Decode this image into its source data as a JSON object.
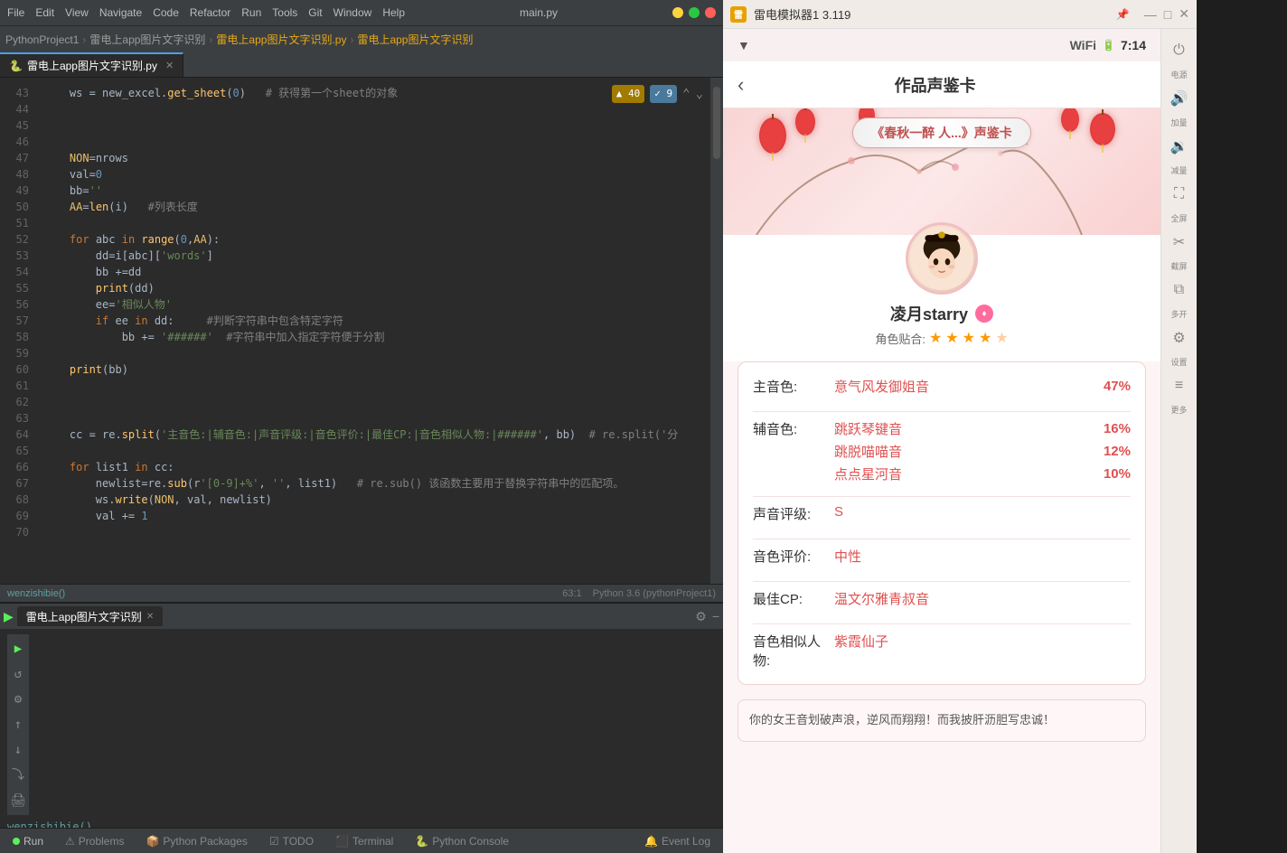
{
  "pycharm": {
    "title_bar": {
      "project": "PythonProject1",
      "menus": [
        "File",
        "Edit",
        "View",
        "Navigate",
        "Code",
        "Refactor",
        "Run",
        "Tools",
        "Git",
        "Window",
        "Help"
      ],
      "file": "main.py"
    },
    "breadcrumb": {
      "project": "PythonProject1",
      "file1": "雷电上app图片文字识别",
      "file2": "雷电上app图片文字识别.py",
      "file3": "雷电上app图片文字识别"
    },
    "tab": {
      "label": "雷电上app图片文字识别.py"
    },
    "warnings": {
      "warn_count": "▲ 40",
      "info_count": "✓ 9"
    },
    "code_lines": [
      {
        "num": "43",
        "content": "    ws = new_excel.get_sheet(0)   # 获得第一个sheet的对象"
      },
      {
        "num": "44",
        "content": ""
      },
      {
        "num": "45",
        "content": ""
      },
      {
        "num": "46",
        "content": ""
      },
      {
        "num": "47",
        "content": "    NON=nrows"
      },
      {
        "num": "48",
        "content": "    val=0"
      },
      {
        "num": "49",
        "content": "    bb=''"
      },
      {
        "num": "50",
        "content": "    AA=len(i)   #列表长度"
      },
      {
        "num": "51",
        "content": ""
      },
      {
        "num": "52",
        "content": "    for abc in range(0,AA):"
      },
      {
        "num": "53",
        "content": "        dd=i[abc]['words']"
      },
      {
        "num": "54",
        "content": "        bb +=dd"
      },
      {
        "num": "55",
        "content": "        print(dd)"
      },
      {
        "num": "56",
        "content": "        ee='相似人物'"
      },
      {
        "num": "57",
        "content": "        if ee in dd:     #判断字符串中包含特定字符"
      },
      {
        "num": "58",
        "content": "            bb += '######'  #字符串中加入指定字符便于分割"
      },
      {
        "num": "59",
        "content": ""
      },
      {
        "num": "60",
        "content": "    print(bb)"
      },
      {
        "num": "61",
        "content": ""
      },
      {
        "num": "62",
        "content": ""
      },
      {
        "num": "63",
        "content": ""
      },
      {
        "num": "64",
        "content": "    cc = re.split('主音色:|辅音色:|声音评级:|音色评价:|最佳CP:|音色相似人物:|######', bb)  # re.split('分"
      },
      {
        "num": "65",
        "content": ""
      },
      {
        "num": "66",
        "content": "    for list1 in cc:"
      },
      {
        "num": "67",
        "content": "        newlist=re.sub(r'[0-9]+%', '', list1)   # re.sub() 该函数主要用于替换字符串中的匹配项。"
      },
      {
        "num": "68",
        "content": "        ws.write(NON, val, newlist)"
      },
      {
        "num": "69",
        "content": "        val += 1"
      },
      {
        "num": "70",
        "content": ""
      }
    ],
    "status_line": {
      "func": "wenzishibie()",
      "position": "63:1",
      "python_version": "Python 3.6 (pythonProject1)"
    },
    "bottom_panel": {
      "run_tab": "雷电上app图片文字识别",
      "output": "wenzishibie()"
    },
    "status_bar": {
      "run_label": "Run",
      "problems_label": "Problems",
      "python_packages_label": "Python Packages",
      "todo_label": "TODO",
      "terminal_label": "Terminal",
      "python_console_label": "Python Console",
      "event_log_label": "Event Log"
    }
  },
  "emulator": {
    "title": "雷电模拟器1 3.119",
    "status_bar": {
      "time": "7:14"
    },
    "page_title": "作品声鉴卡",
    "card_badge": "《春秋一醉 人...》声鉴卡",
    "username": "凌月starry",
    "rating_label": "角色贴合:",
    "stars_count": 4,
    "main_color_label": "主音色:",
    "main_color_value": "意气风发御姐音",
    "main_color_percent": "47%",
    "sub_color_label": "辅音色:",
    "sub_color_values": [
      {
        "name": "跳跃琴键音",
        "percent": "16%"
      },
      {
        "name": "跳脱喵喵音",
        "percent": "12%"
      },
      {
        "name": "点点星河音",
        "percent": "10%"
      }
    ],
    "rating_grade_label": "声音评级:",
    "rating_grade_value": "S",
    "tone_eval_label": "音色评价:",
    "tone_eval_value": "中性",
    "best_cp_label": "最佳CP:",
    "best_cp_value": "温文尔雅青叔音",
    "similar_label": "音色相似人物:",
    "similar_value": "紫霞仙子",
    "comment": "你的女王音划破声浪，逆风而翔翔！而我披肝沥胆写忠诚！",
    "right_toolbar": {
      "power": "⏻",
      "volume_up": "加量",
      "volume_down": "减量",
      "fullscreen": "全屏",
      "cut": "截屏",
      "more": "多开",
      "settings": "设置",
      "more2": "更多"
    }
  }
}
